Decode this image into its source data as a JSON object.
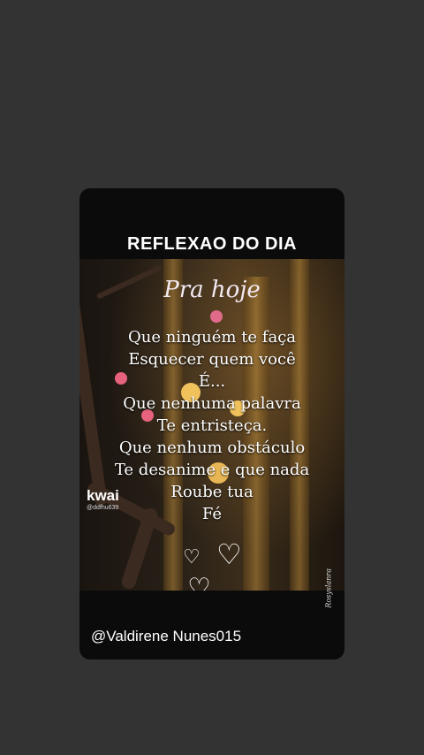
{
  "card": {
    "title": "REFLEXAO DO DIA",
    "subtitle": "Pra hoje",
    "poem_lines": [
      "Que ninguém te faça",
      "Esquecer quem você",
      "É...",
      "Que nenhuma palavra",
      "Te entristeça.",
      "Que nenhum obstáculo",
      "Te desanime e que nada",
      "Roube tua",
      "Fé"
    ],
    "watermark_logo": "kwai",
    "watermark_user": "@ddfhu639",
    "signature": "Rosyslanra",
    "footer_handle": "@Valdirene Nunes015"
  },
  "colors": {
    "background": "#333333",
    "card": "#0b0b0b",
    "text": "#ffffff"
  },
  "icons": [
    "heart-icon",
    "kwai-logo-icon"
  ]
}
